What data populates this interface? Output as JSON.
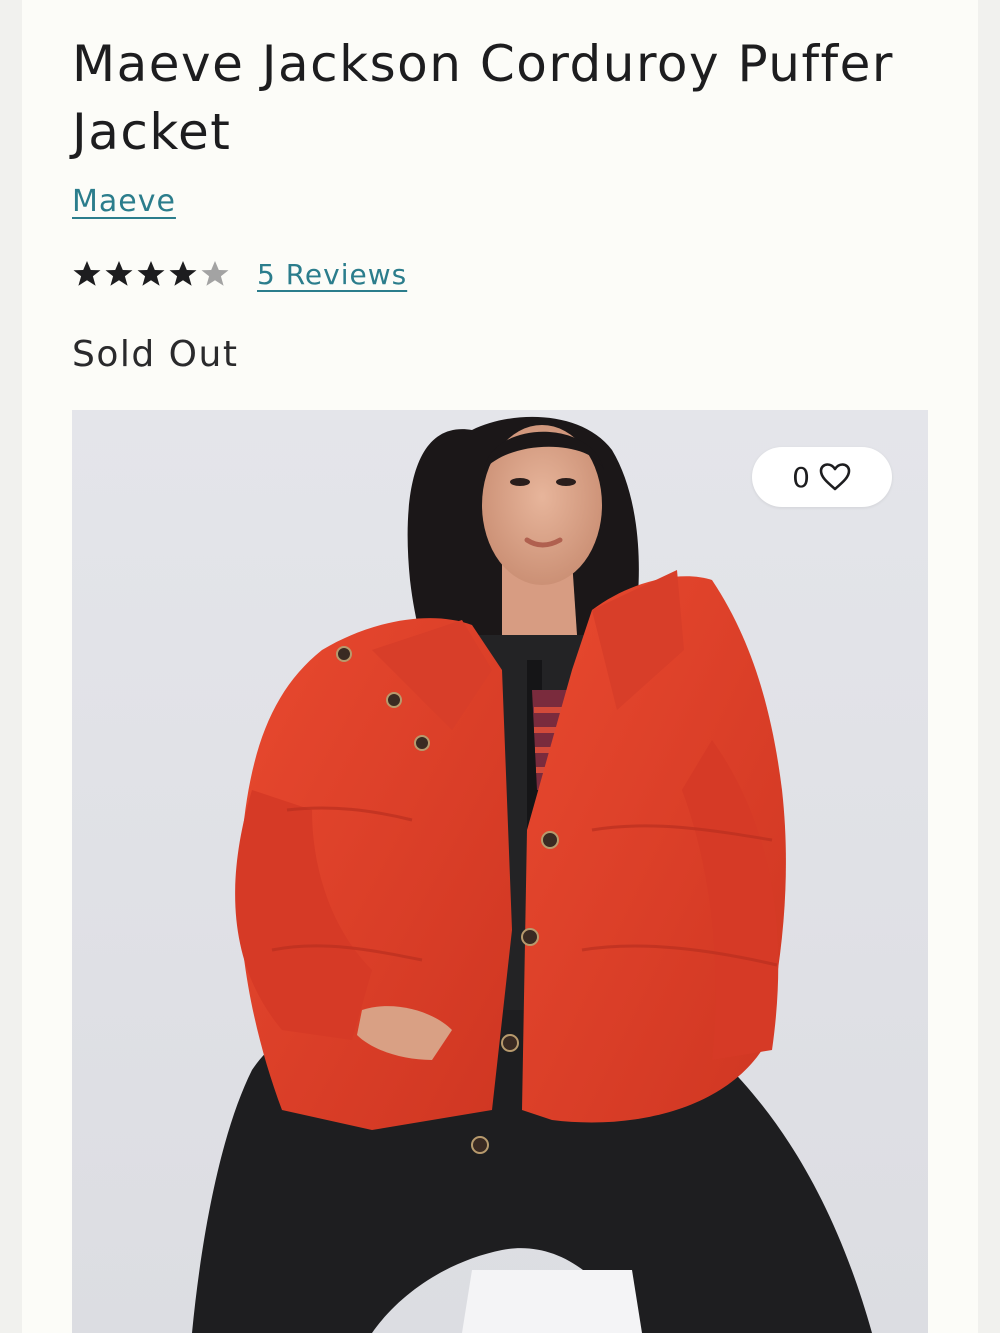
{
  "product": {
    "title": "Maeve Jackson Corduroy Puffer Jacket",
    "brand": "Maeve",
    "rating": {
      "value": 4,
      "max": 5,
      "reviews_label": "5 Reviews"
    },
    "availability": "Sold Out"
  },
  "image": {
    "favorite_count": "0",
    "favorite_icon": "heart-outline-icon",
    "alt": "Model wearing red corduroy puffer jacket over black denim overalls"
  },
  "colors": {
    "link": "#2b7d8c",
    "text": "#1d1d1f",
    "star_filled": "#1d1d1f",
    "star_empty": "#a3a3a3",
    "jacket": "#e0412e"
  }
}
